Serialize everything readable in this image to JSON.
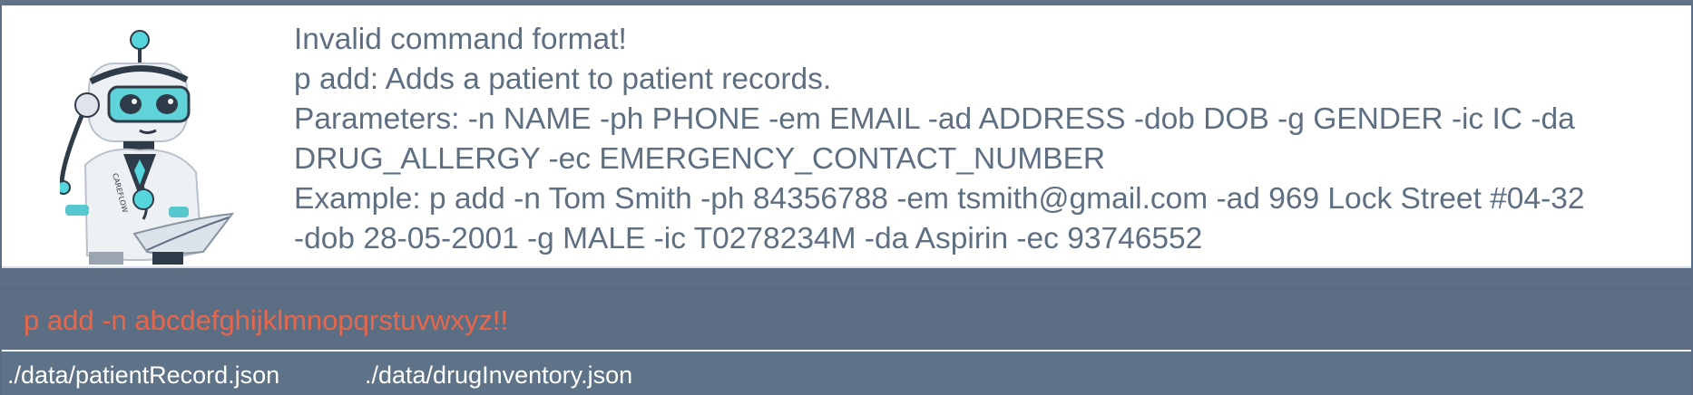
{
  "result_display": {
    "lines": [
      "Invalid command format!",
      "p add: Adds a patient to patient records.",
      "Parameters: -n NAME -ph PHONE -em EMAIL -ad ADDRESS -dob DOB -g GENDER -ic IC -da",
      "DRUG_ALLERGY -ec EMERGENCY_CONTACT_NUMBER",
      "Example: p add -n Tom Smith -ph 84356788 -em tsmith@gmail.com -ad 969 Lock Street #04-32",
      "-dob 28-05-2001 -g MALE -ic T0278234M -da Aspirin -ec 93746552"
    ],
    "text_color": "#5f6f82"
  },
  "mascot": {
    "icon": "doctor-robot-icon",
    "coat_lettering": "CAREFLOW"
  },
  "command_box": {
    "value": "p add -n abcdefghijklmnopqrstuvwxyz!!",
    "text_color": "#e8674b"
  },
  "status_bar": {
    "patient_file": "./data/patientRecord.json",
    "drug_file": "./data/drugInventory.json"
  },
  "colors": {
    "background": "#5b6e83",
    "panel": "#ffffff",
    "error_text": "#e8674b"
  }
}
